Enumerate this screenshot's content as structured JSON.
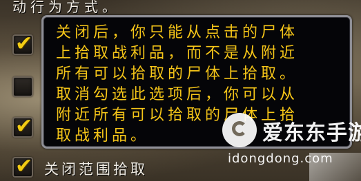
{
  "background": {
    "partial_heading": "动行为方式。"
  },
  "checkboxes": [
    {
      "checked": true
    },
    {
      "checked": false
    },
    {
      "checked": true
    },
    {
      "checked": true,
      "label": "关闭范围拾取"
    }
  ],
  "tooltip": {
    "lines": [
      "关闭后，你只能从点击的尸体",
      "上拾取战利品，而不是从附近",
      "所有可以拾取的尸体上拾取。",
      "取消勾选此选项后，你可以从",
      "附近所有可以拾取的尸体上拾",
      "取战利品。"
    ]
  },
  "watermark": {
    "title": "爱东东手游",
    "url": "idongdong.com"
  },
  "colors": {
    "tooltip_text": "#f5c518",
    "check": "#f3cc14",
    "tooltip_border": "#8f8f96"
  }
}
